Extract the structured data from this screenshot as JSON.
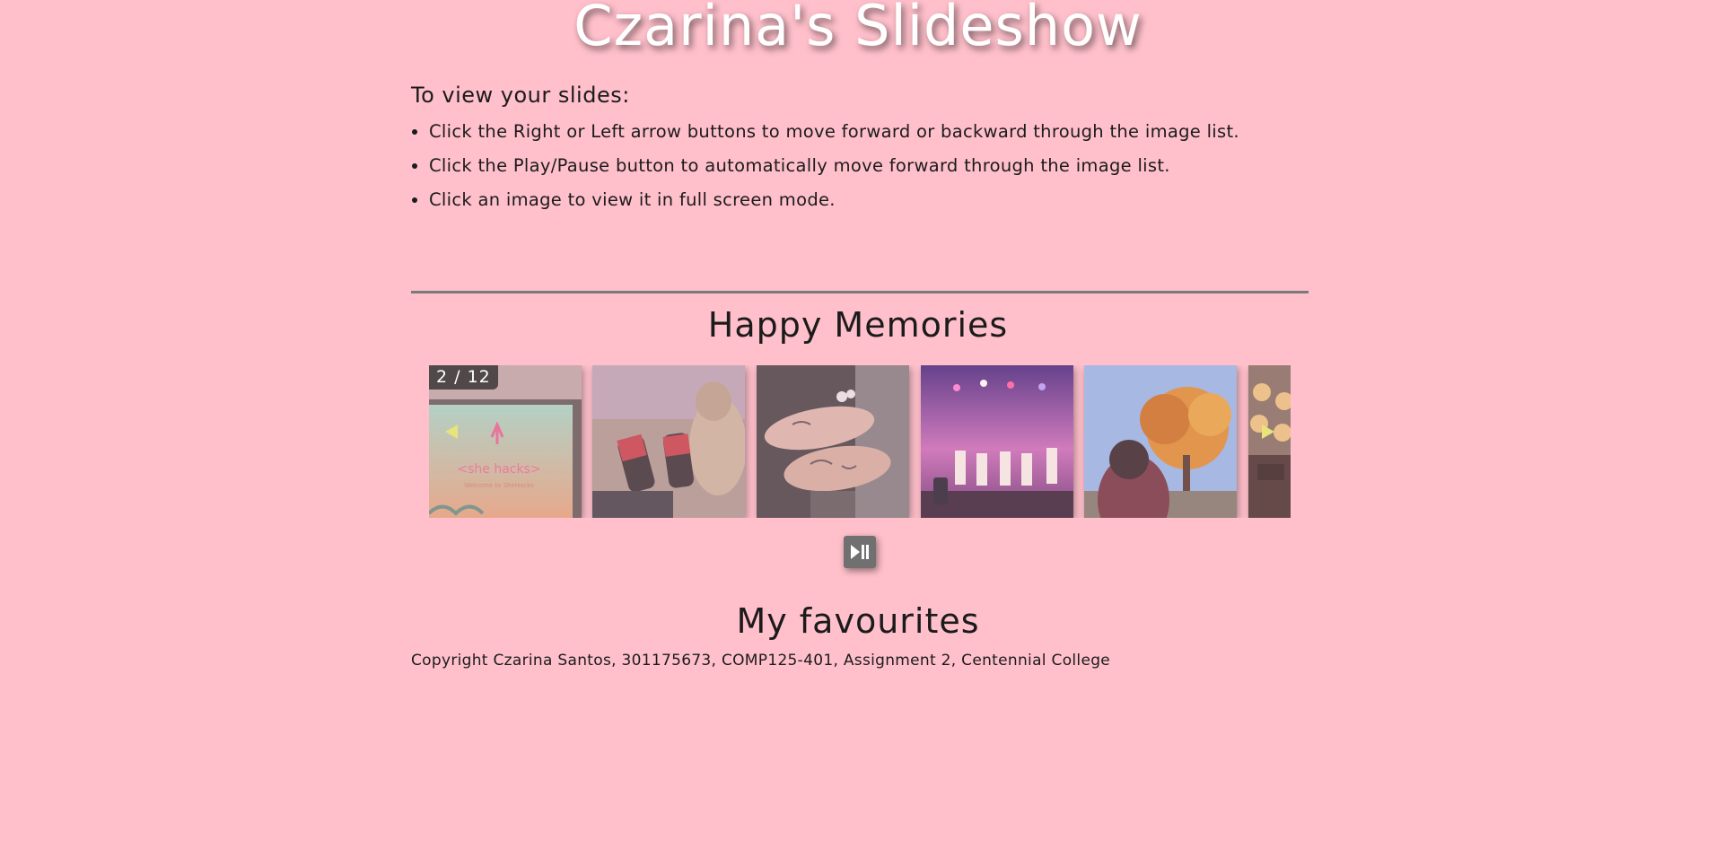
{
  "header": {
    "title": "Czarina's Slideshow"
  },
  "intro": {
    "heading": "To view your slides:",
    "instructions": [
      "Click the Right or Left arrow buttons to move forward or backward through the image list.",
      "Click the Play/Pause button to automatically move forward through the image list.",
      "Click an image to view it in full screen mode."
    ]
  },
  "memories": {
    "title": "Happy Memories",
    "counter": "2 / 12",
    "slides": [
      {
        "icon": "presentation-screen-photo"
      },
      {
        "icon": "socks-and-dog-photo"
      },
      {
        "icon": "tattooed-hands-photo"
      },
      {
        "icon": "concert-stage-photo"
      },
      {
        "icon": "autumn-tree-photo"
      },
      {
        "icon": "pastries-photo"
      }
    ],
    "slide_text": {
      "screen_caption": "<she hacks>",
      "screen_subcaption": "Welcome to SheHacks"
    },
    "controls": {
      "prev_icon": "left-arrow-icon",
      "next_icon": "right-arrow-icon",
      "play_icon": "play-pause-icon"
    }
  },
  "favourites": {
    "title": "My favourites"
  },
  "footer": {
    "copyright": "Copyright Czarina Santos, 301175673, COMP125-401, Assignment 2, Centennial College"
  },
  "colors": {
    "background": "#ffc0cb",
    "arrow": "#e8e37a",
    "button": "#707070",
    "divider": "#7a7a7a"
  }
}
